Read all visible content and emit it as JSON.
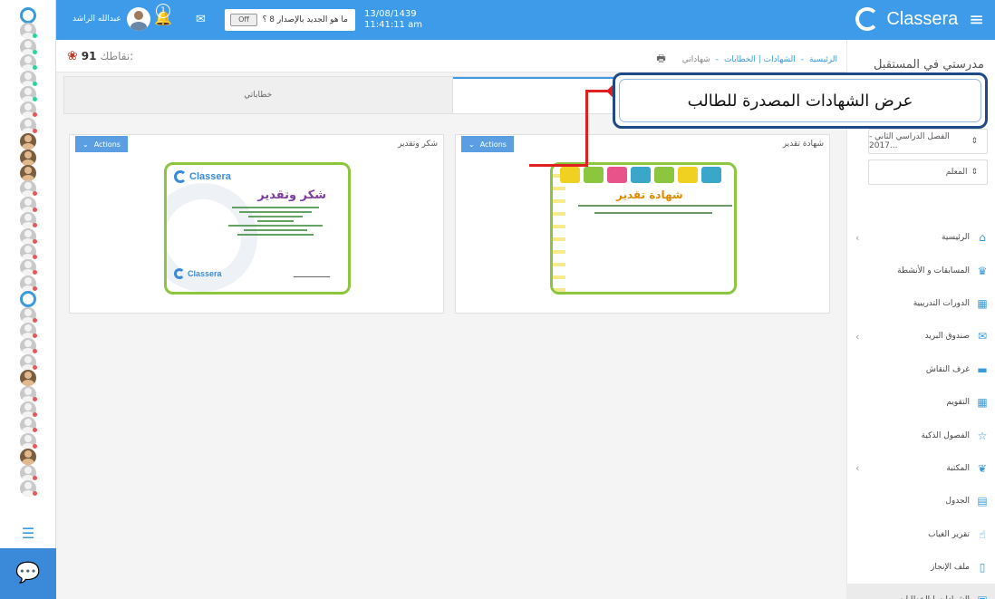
{
  "app": {
    "brand": "Classera",
    "school": "مدرستي في المستقبل"
  },
  "header": {
    "user_name": "عبدالله الراشد",
    "notifications": "1",
    "whats_new": "ما هو الجديد بالإصدار 8 ؟",
    "toggle": "Off",
    "date": "13/08/1439",
    "time": "11:41:11 am"
  },
  "points": {
    "label": "نقاطك:",
    "value": "91"
  },
  "breadcrumb": [
    "الرئيسية",
    "الشهادات | الخطابات",
    "شهاداتي"
  ],
  "sidebar": {
    "semester": "الفصل الدراسي الثاني - 2017...",
    "role": "المعلم",
    "items": [
      {
        "label": "الرئيسية",
        "icon": "home-icon",
        "chevron": true
      },
      {
        "label": "المسابقات و الأنشطة",
        "icon": "trophy-icon",
        "chevron": false
      },
      {
        "label": "الدورات التدريبية",
        "icon": "grid-icon",
        "chevron": false
      },
      {
        "label": "صندوق البريد",
        "icon": "mail-icon",
        "chevron": true
      },
      {
        "label": "غرف النقاش",
        "icon": "chat-icon",
        "chevron": false
      },
      {
        "label": "التقويم",
        "icon": "calendar-icon",
        "chevron": false
      },
      {
        "label": "الفصول الذكية",
        "icon": "star-icon",
        "chevron": false
      },
      {
        "label": "المكتبة",
        "icon": "leaf-icon",
        "chevron": true
      },
      {
        "label": "الجدول",
        "icon": "table-icon",
        "chevron": false
      },
      {
        "label": "تقرير الغياب",
        "icon": "hand-icon",
        "chevron": false
      },
      {
        "label": "ملف الإنجاز",
        "icon": "file-icon",
        "chevron": false
      },
      {
        "label": "الشهادات | الخطابات",
        "icon": "qr-icon",
        "chevron": true
      }
    ]
  },
  "tabs": {
    "letters": "خطاباتي"
  },
  "cards": [
    {
      "title": "شكر وتقدير",
      "actions": "Actions",
      "cert_brand": "Classera",
      "cert_heading": "شكر وتقدير"
    },
    {
      "title": "شهادة تقدير",
      "actions": "Actions",
      "cert_heading": "شهادة تقدير"
    }
  ],
  "callout": "عرض الشهادات المصدرة للطالب",
  "colors": {
    "topbar": "#3d9be9",
    "accent": "#3b9ad9",
    "callout_border": "#1f4a87",
    "arrow": "#e02020"
  }
}
